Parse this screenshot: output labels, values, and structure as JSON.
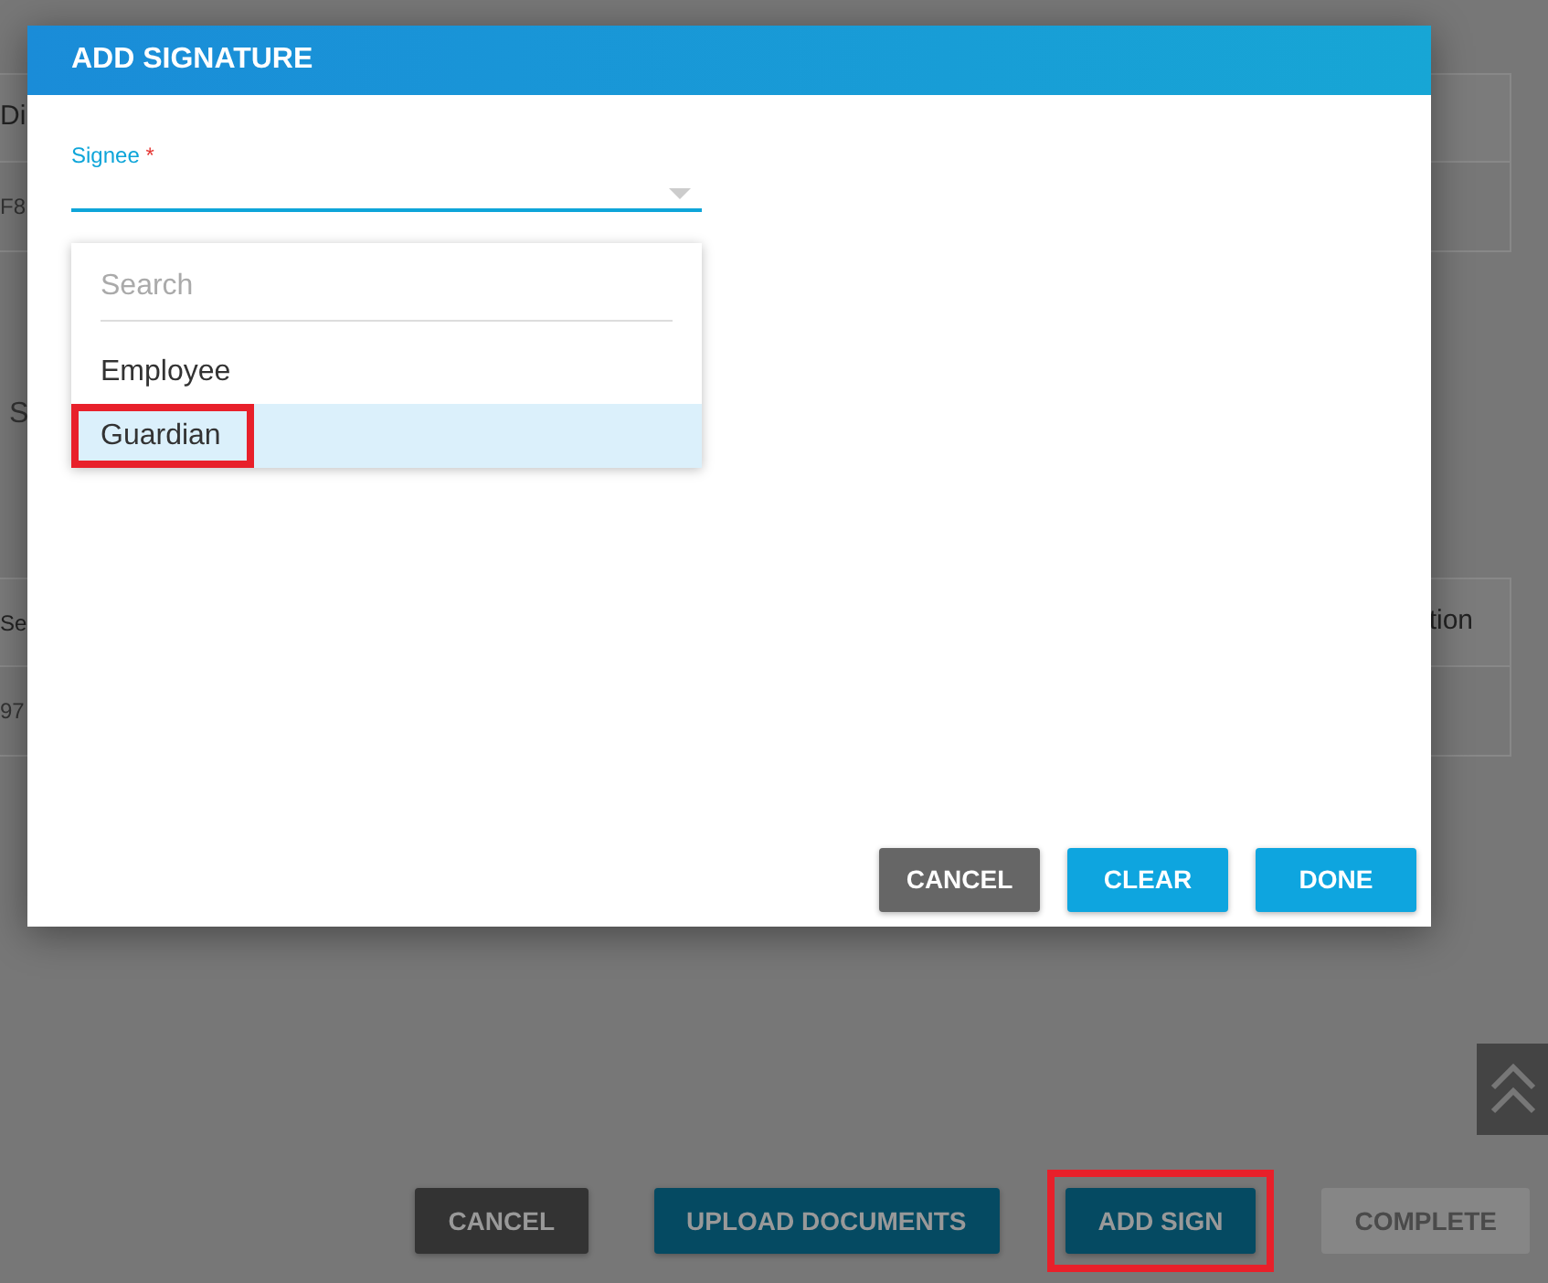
{
  "background": {
    "table_1": {
      "header": "Di",
      "cell": "F8"
    },
    "section_label": "S",
    "table_2": {
      "header_left": "Se",
      "header_right": "tion",
      "cell": "97"
    },
    "actions": [
      {
        "label": "CANCEL",
        "kind": "dark",
        "disabled": false,
        "highlighted": false
      },
      {
        "label": "UPLOAD DOCUMENTS",
        "kind": "primary",
        "disabled": false,
        "highlighted": false
      },
      {
        "label": "ADD SIGN",
        "kind": "primary",
        "disabled": false,
        "highlighted": true
      },
      {
        "label": "COMPLETE",
        "kind": "primary",
        "disabled": true,
        "highlighted": false
      }
    ]
  },
  "dialog": {
    "title": "ADD SIGNATURE",
    "field": {
      "label": "Signee",
      "required": "*",
      "expanded": true
    },
    "dropdown": {
      "search": {
        "placeholder": "Search"
      },
      "options": [
        {
          "label": "Employee",
          "selected": false,
          "highlighted": false
        },
        {
          "label": "Guardian",
          "selected": true,
          "highlighted": true
        }
      ]
    },
    "buttons": [
      {
        "label": "CANCEL",
        "kind": "dark"
      },
      {
        "label": "CLEAR",
        "kind": "primary"
      },
      {
        "label": "DONE",
        "kind": "primary"
      }
    ]
  }
}
